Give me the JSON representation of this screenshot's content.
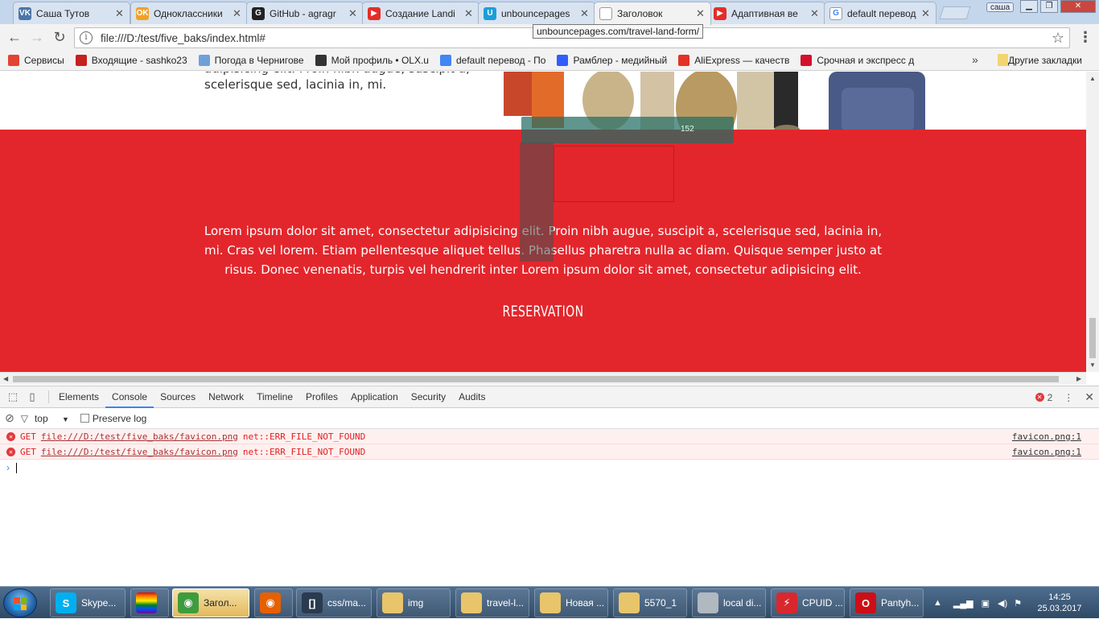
{
  "tabs": [
    {
      "label": "Саша Тутов",
      "icon": "vk-icon",
      "color": "#4a76a8",
      "glyph": "VK"
    },
    {
      "label": "Одноклассники",
      "icon": "ok-icon",
      "color": "#f2a127",
      "glyph": "OK"
    },
    {
      "label": "GitHub - agragr",
      "icon": "github-icon",
      "color": "#222222",
      "glyph": "G"
    },
    {
      "label": "Создание Landi",
      "icon": "youtube-icon",
      "color": "#e52d27",
      "glyph": "▶"
    },
    {
      "label": "unbouncepages",
      "icon": "unbounce-icon",
      "color": "#1a9ed9",
      "glyph": "U"
    },
    {
      "label": "Заголовок",
      "icon": "page-icon",
      "color": "#ffffff",
      "glyph": ""
    },
    {
      "label": "Адаптивная ве",
      "icon": "youtube-icon",
      "color": "#e52d27",
      "glyph": "▶"
    },
    {
      "label": "default перевод",
      "icon": "google-icon",
      "color": "#ffffff",
      "glyph": "G"
    }
  ],
  "active_tab_index": 5,
  "window": {
    "user": "саша"
  },
  "address": {
    "url": "file:///D:/test/five_baks/index.html#",
    "tooltip": "unbouncepages.com/travel-land-form/"
  },
  "bookmarks": [
    {
      "label": "Сервисы",
      "icon": "apps-icon",
      "color": "#e34234"
    },
    {
      "label": "Входящие - sashko23",
      "icon": "gmail-icon",
      "color": "#c5221f"
    },
    {
      "label": "Погода в Чернигове",
      "icon": "weather-icon",
      "color": "#6ea0d8"
    },
    {
      "label": "Мой профиль • OLX.u",
      "icon": "olx-icon",
      "color": "#333333"
    },
    {
      "label": "default перевод - По",
      "icon": "google-icon",
      "color": "#4285f4"
    },
    {
      "label": "Рамблер - медийный",
      "icon": "rambler-icon",
      "color": "#315efb"
    },
    {
      "label": "AliExpress — качеств",
      "icon": "aliexpress-icon",
      "color": "#e43225"
    },
    {
      "label": "Срочная и экспресс д",
      "icon": "delivery-icon",
      "color": "#d4102b"
    }
  ],
  "bookmarks_other": "Другие закладки",
  "page": {
    "white_text": "adipisicing elit. Proin nibh augue, suscipit a, scelerisque sed, lacinia in, mi.",
    "red_text": "Lorem ipsum dolor sit amet, consectetur adipisicing elit. Proin nibh augue, suscipit a, scelerisque sed, lacinia in, mi. Cras vel lorem. Etiam pellentesque aliquet tellus. Phasellus pharetra nulla ac diam. Quisque semper justo at risus. Donec venenatis, turpis vel hendrerit inter Lorem ipsum dolor sit amet, consectetur adipisicing elit.",
    "button": "RESERVATION",
    "ruler_value": "152",
    "accent_red": "#e3262c"
  },
  "devtools": {
    "tabs": [
      "Elements",
      "Console",
      "Sources",
      "Network",
      "Timeline",
      "Profiles",
      "Application",
      "Security",
      "Audits"
    ],
    "active_tab": "Console",
    "error_count": "2",
    "context": "top",
    "preserve_log": "Preserve log",
    "logs": [
      {
        "method": "GET",
        "url": "file:///D:/test/five_baks/favicon.png",
        "error": "net::ERR_FILE_NOT_FOUND",
        "source": "favicon.png:1"
      },
      {
        "method": "GET",
        "url": "file:///D:/test/five_baks/favicon.png",
        "error": "net::ERR_FILE_NOT_FOUND",
        "source": "favicon.png:1"
      }
    ]
  },
  "taskbar": {
    "items": [
      {
        "label": "Skype...",
        "icon": "skype-icon",
        "color": "#00aff0",
        "glyph": "S"
      },
      {
        "label": "",
        "icon": "lgbt-icon",
        "color": "#8e44ad",
        "glyph": ""
      },
      {
        "label": "Загол...",
        "icon": "chrome-icon",
        "color": "#3e9c3f",
        "glyph": "◉"
      },
      {
        "label": "",
        "icon": "firefox-icon",
        "color": "#e66000",
        "glyph": "◉"
      },
      {
        "label": "css/ma...",
        "icon": "brackets-icon",
        "color": "#2a3a4f",
        "glyph": "[]"
      },
      {
        "label": "img",
        "icon": "folder-icon",
        "color": "#e8c56a",
        "glyph": ""
      },
      {
        "label": "travel-l...",
        "icon": "folder-icon",
        "color": "#e8c56a",
        "glyph": ""
      },
      {
        "label": "Новая ...",
        "icon": "folder-icon",
        "color": "#e8c56a",
        "glyph": ""
      },
      {
        "label": "5570_1",
        "icon": "folder-icon",
        "color": "#e8c56a",
        "glyph": ""
      },
      {
        "label": "local di...",
        "icon": "drive-icon",
        "color": "#b0b8c0",
        "glyph": ""
      },
      {
        "label": "CPUID ...",
        "icon": "cpuid-icon",
        "color": "#d9272e",
        "glyph": "⚡"
      },
      {
        "label": "Pantyh...",
        "icon": "opera-icon",
        "color": "#cc0f16",
        "glyph": "O"
      }
    ],
    "clock_time": "14:25",
    "clock_date": "25.03.2017"
  }
}
